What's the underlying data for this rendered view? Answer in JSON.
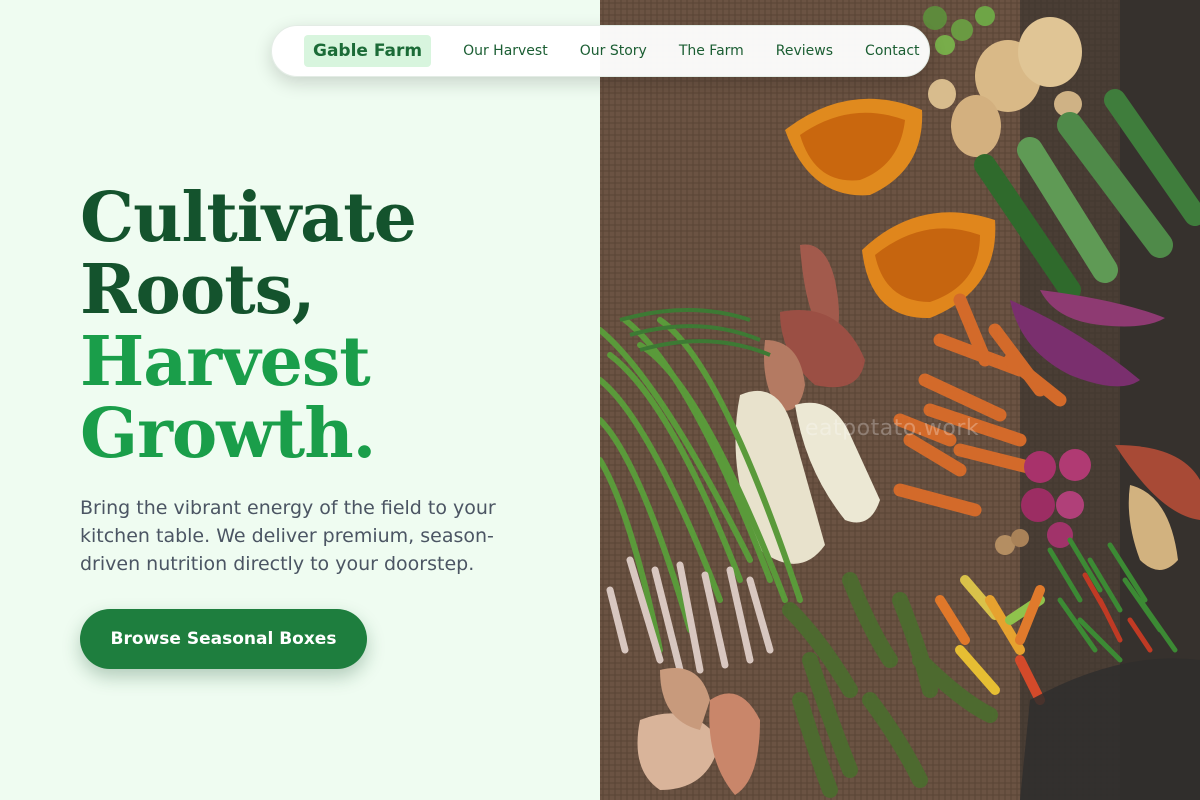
{
  "nav": {
    "brand": "Gable Farm",
    "links": [
      "Our Harvest",
      "Our Story",
      "The Farm",
      "Reviews",
      "Contact"
    ]
  },
  "hero": {
    "title_line1": "Cultivate",
    "title_line2": "Roots,",
    "title_line3": "Harvest",
    "title_line4": "Growth.",
    "subtitle": "Bring the vibrant energy of the field to your kitchen table. We deliver premium, season-driven nutrition directly to your doorstep.",
    "cta_label": "Browse Seasonal Boxes"
  },
  "image": {
    "watermark": "eatpotato.work"
  },
  "colors": {
    "background": "#effcf1",
    "title_dark": "#14532d",
    "title_bright": "#1a9e4a",
    "cta": "#1e7e3e",
    "brand_badge": "#d8f5de"
  }
}
